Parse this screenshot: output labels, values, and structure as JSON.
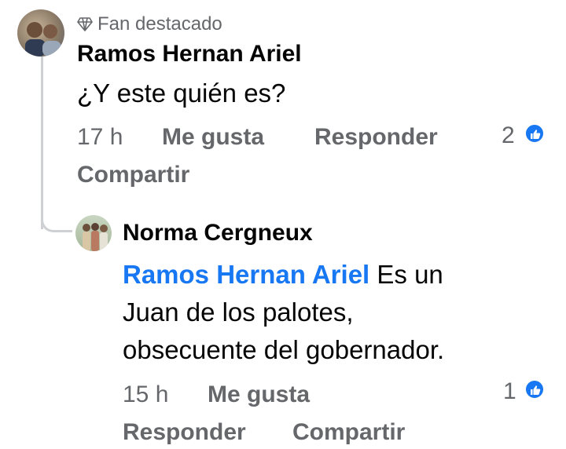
{
  "comment": {
    "badge_label": "Fan destacado",
    "author": "Ramos Hernan Ariel",
    "text": "¿Y este quién es?",
    "time": "17 h",
    "like_label": "Me gusta",
    "reply_label": "Responder",
    "share_label": "Compartir",
    "reaction_count": "2",
    "reaction_icon": "thumbs-up-icon"
  },
  "reply": {
    "author": "Norma Cergneux",
    "mention": "Ramos Hernan Ariel",
    "text_line1": " Es un",
    "text_line2": "Juan de los palotes,",
    "text_line3": "obsecuente del gobernador.",
    "time": "15 h",
    "like_label": "Me gusta",
    "reply_label": "Responder",
    "share_label": "Compartir",
    "reaction_count": "1",
    "reaction_icon": "thumbs-up-icon"
  },
  "colors": {
    "link_blue": "#1877f2",
    "muted_gray": "#65676b",
    "text_black": "#050505"
  }
}
